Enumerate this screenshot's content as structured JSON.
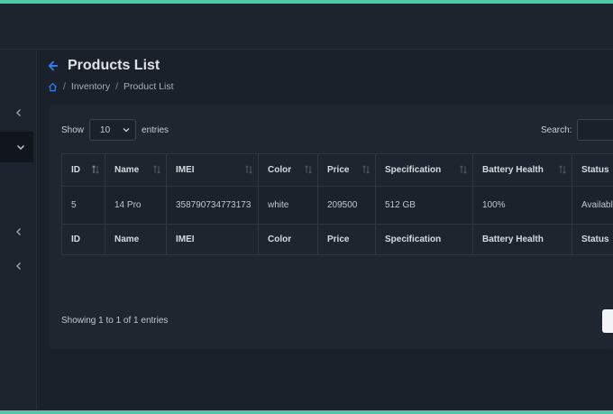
{
  "page": {
    "title": "Products List",
    "breadcrumb": [
      "Inventory",
      "Product List"
    ]
  },
  "table_controls": {
    "show_label": "Show",
    "entries_value": "10",
    "entries_label": "entries",
    "search_label": "Search:"
  },
  "table": {
    "columns": [
      "ID",
      "Name",
      "IMEI",
      "Color",
      "Price",
      "Specification",
      "Battery Health",
      "Status"
    ],
    "rows": [
      [
        "5",
        "14 Pro",
        "358790734773173",
        "white",
        "209500",
        "512 GB",
        "100%",
        "Available"
      ]
    ],
    "info": "Showing 1 to 1 of 1 entries"
  },
  "icons": {
    "back": "arrow-left-icon",
    "home": "home-icon",
    "sort": "sort-arrows-icon",
    "sidebar": "chevron-icon"
  },
  "colors": {
    "accent": "#4fc8a6",
    "link": "#2f7df6",
    "background": "#1b212a"
  }
}
